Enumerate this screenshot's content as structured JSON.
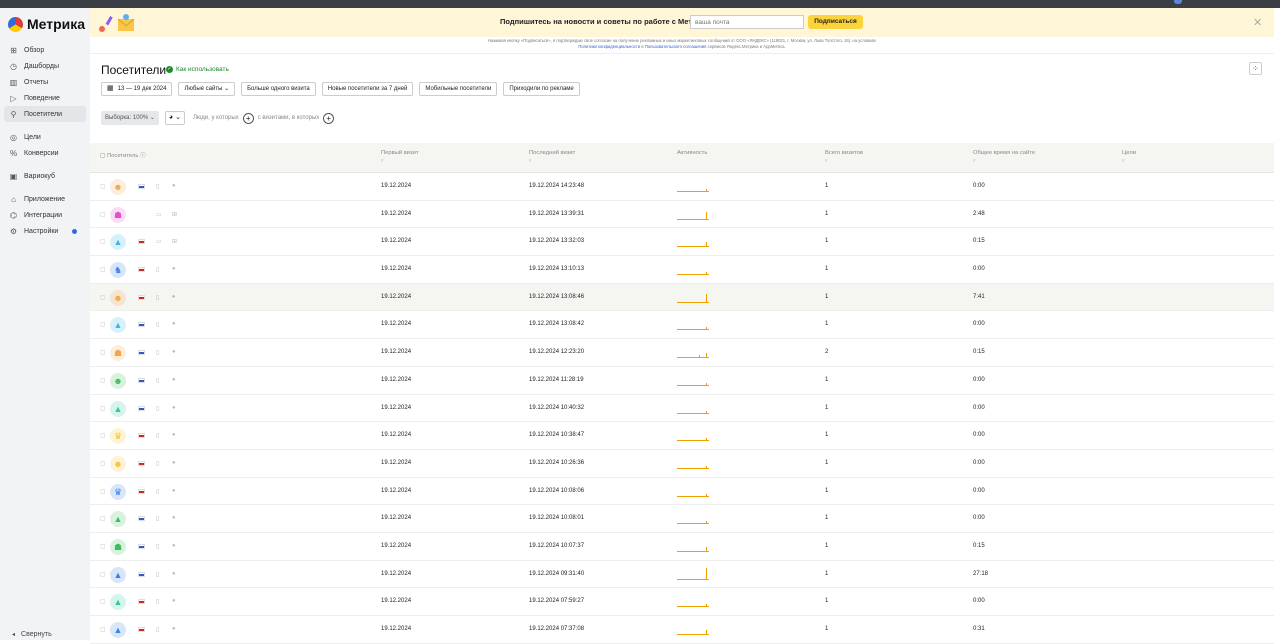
{
  "app": {
    "name": "Метрика",
    "collapse_label": "Свернуть"
  },
  "sidebar": {
    "items": [
      {
        "label": "Обзор",
        "icon": "grid-icon"
      },
      {
        "label": "Дашборды",
        "icon": "dashboard-icon"
      },
      {
        "label": "Отчеты",
        "icon": "reports-icon"
      },
      {
        "label": "Поведение",
        "icon": "play-icon"
      },
      {
        "label": "Посетители",
        "icon": "person-icon",
        "active": true
      },
      {
        "label": "Цели",
        "icon": "target-icon",
        "gap_before": true
      },
      {
        "label": "Конверсии",
        "icon": "percent-icon"
      },
      {
        "label": "Вариокуб",
        "icon": "cube-icon",
        "gap_before": true
      },
      {
        "label": "Приложение",
        "icon": "app-icon",
        "gap_before": true
      },
      {
        "label": "Интеграции",
        "icon": "integrations-icon"
      },
      {
        "label": "Настройки",
        "icon": "gear-icon",
        "badge": true
      }
    ]
  },
  "banner": {
    "text": "Подпишитесь на новости и советы по работе с Метрикой",
    "email_placeholder": "ваша почта",
    "subscribe_label": "Подписаться",
    "legal_text": "Нажимая кнопку «Подписаться», я подтверждаю свое согласие на получение рекламных и иных маркетинговых сообщений от ООО «ЯНДЕКС» (119021, г. Москва, ул. Льва Толстого, 16), на условиях",
    "legal_link1": "Политики конфиденциальности",
    "legal_and": "и",
    "legal_link2": "Пользовательского соглашения",
    "legal_tail": "сервисов Яндекс.Метрика и AppMetrica."
  },
  "page": {
    "title": "Посетители",
    "howto": "Как использовать"
  },
  "filters": {
    "date": "13 — 19 дек 2024",
    "items": [
      "Любые сайты",
      "Больше одного визита",
      "Новые посетители за 7 дней",
      "Мобильные посетители",
      "Приходили по рекламе"
    ]
  },
  "segment": {
    "sample": "Выборка: 100%",
    "people_text": "Люди, у которых",
    "visits_text": "с визитами, в которых"
  },
  "table": {
    "columns": [
      "Посетитель",
      "Первый визит",
      "Последний визит",
      "Активность",
      "Всего визитов",
      "Общее время на сайте",
      "Цели"
    ],
    "rows": [
      {
        "first": "19.12.2024",
        "last": "19.12.2024 14:23:48",
        "visits": "1",
        "time": "0:00",
        "avatar": "#f3a64a",
        "desktop": false,
        "spark": [
          0.15
        ]
      },
      {
        "first": "19.12.2024",
        "last": "19.12.2024 13:39:31",
        "visits": "1",
        "time": "2:48",
        "avatar": "#e84fc9",
        "desktop": true,
        "no_flag": true,
        "spark": [
          0.6
        ]
      },
      {
        "first": "19.12.2024",
        "last": "19.12.2024 13:32:03",
        "visits": "1",
        "time": "0:15",
        "avatar": "#39b7e8",
        "desktop": true,
        "spark": [
          0.3
        ]
      },
      {
        "first": "19.12.2024",
        "last": "19.12.2024 13:10:13",
        "visits": "1",
        "time": "0:00",
        "avatar": "#3c82e6",
        "desktop": false,
        "spark": [
          0.15
        ]
      },
      {
        "first": "19.12.2024",
        "last": "19.12.2024 13:08:46",
        "visits": "1",
        "time": "7:41",
        "avatar": "#f3a64a",
        "desktop": false,
        "android": true,
        "spark": [
          0.7
        ],
        "hl": true
      },
      {
        "first": "19.12.2024",
        "last": "19.12.2024 13:08:42",
        "visits": "1",
        "time": "0:00",
        "avatar": "#39b7e8",
        "desktop": false,
        "spark": [
          0.15
        ]
      },
      {
        "first": "19.12.2024",
        "last": "19.12.2024 12:23:20",
        "visits": "2",
        "time": "0:15",
        "avatar": "#f3a64a",
        "desktop": false,
        "spark": [
          0.2,
          0.3
        ]
      },
      {
        "first": "19.12.2024",
        "last": "19.12.2024 11:28:19",
        "visits": "1",
        "time": "0:00",
        "avatar": "#3bbf5c",
        "desktop": false,
        "spark": [
          0.15
        ]
      },
      {
        "first": "19.12.2024",
        "last": "19.12.2024 10:40:32",
        "visits": "1",
        "time": "0:00",
        "avatar": "#2fc9a0",
        "desktop": false,
        "spark": [
          0.15
        ]
      },
      {
        "first": "19.12.2024",
        "last": "19.12.2024 10:38:47",
        "visits": "1",
        "time": "0:00",
        "avatar": "#f5c431",
        "desktop": false,
        "spark": [
          0.15
        ]
      },
      {
        "first": "19.12.2024",
        "last": "19.12.2024 10:26:36",
        "visits": "1",
        "time": "0:00",
        "avatar": "#f5c431",
        "desktop": false,
        "spark": [
          0.15
        ]
      },
      {
        "first": "19.12.2024",
        "last": "19.12.2024 10:08:06",
        "visits": "1",
        "time": "0:00",
        "avatar": "#3c82e6",
        "desktop": false,
        "spark": [
          0.15
        ]
      },
      {
        "first": "19.12.2024",
        "last": "19.12.2024 10:08:01",
        "visits": "1",
        "time": "0:00",
        "avatar": "#3bbf5c",
        "desktop": false,
        "spark": [
          0.15
        ]
      },
      {
        "first": "19.12.2024",
        "last": "19.12.2024 10:07:37",
        "visits": "1",
        "time": "0:15",
        "avatar": "#3bbf5c",
        "desktop": false,
        "spark": [
          0.3
        ]
      },
      {
        "first": "19.12.2024",
        "last": "19.12.2024 09:31:40",
        "visits": "1",
        "time": "27:18",
        "avatar": "#3c82e6",
        "desktop": false,
        "spark": [
          0.9
        ]
      },
      {
        "first": "19.12.2024",
        "last": "19.12.2024 07:59:27",
        "visits": "1",
        "time": "0:00",
        "avatar": "#2fc9a0",
        "desktop": false,
        "spark": [
          0.15
        ]
      },
      {
        "first": "19.12.2024",
        "last": "19.12.2024 07:37:08",
        "visits": "1",
        "time": "0:31",
        "avatar": "#3c82e6",
        "desktop": false,
        "spark": [
          0.35
        ]
      }
    ]
  }
}
